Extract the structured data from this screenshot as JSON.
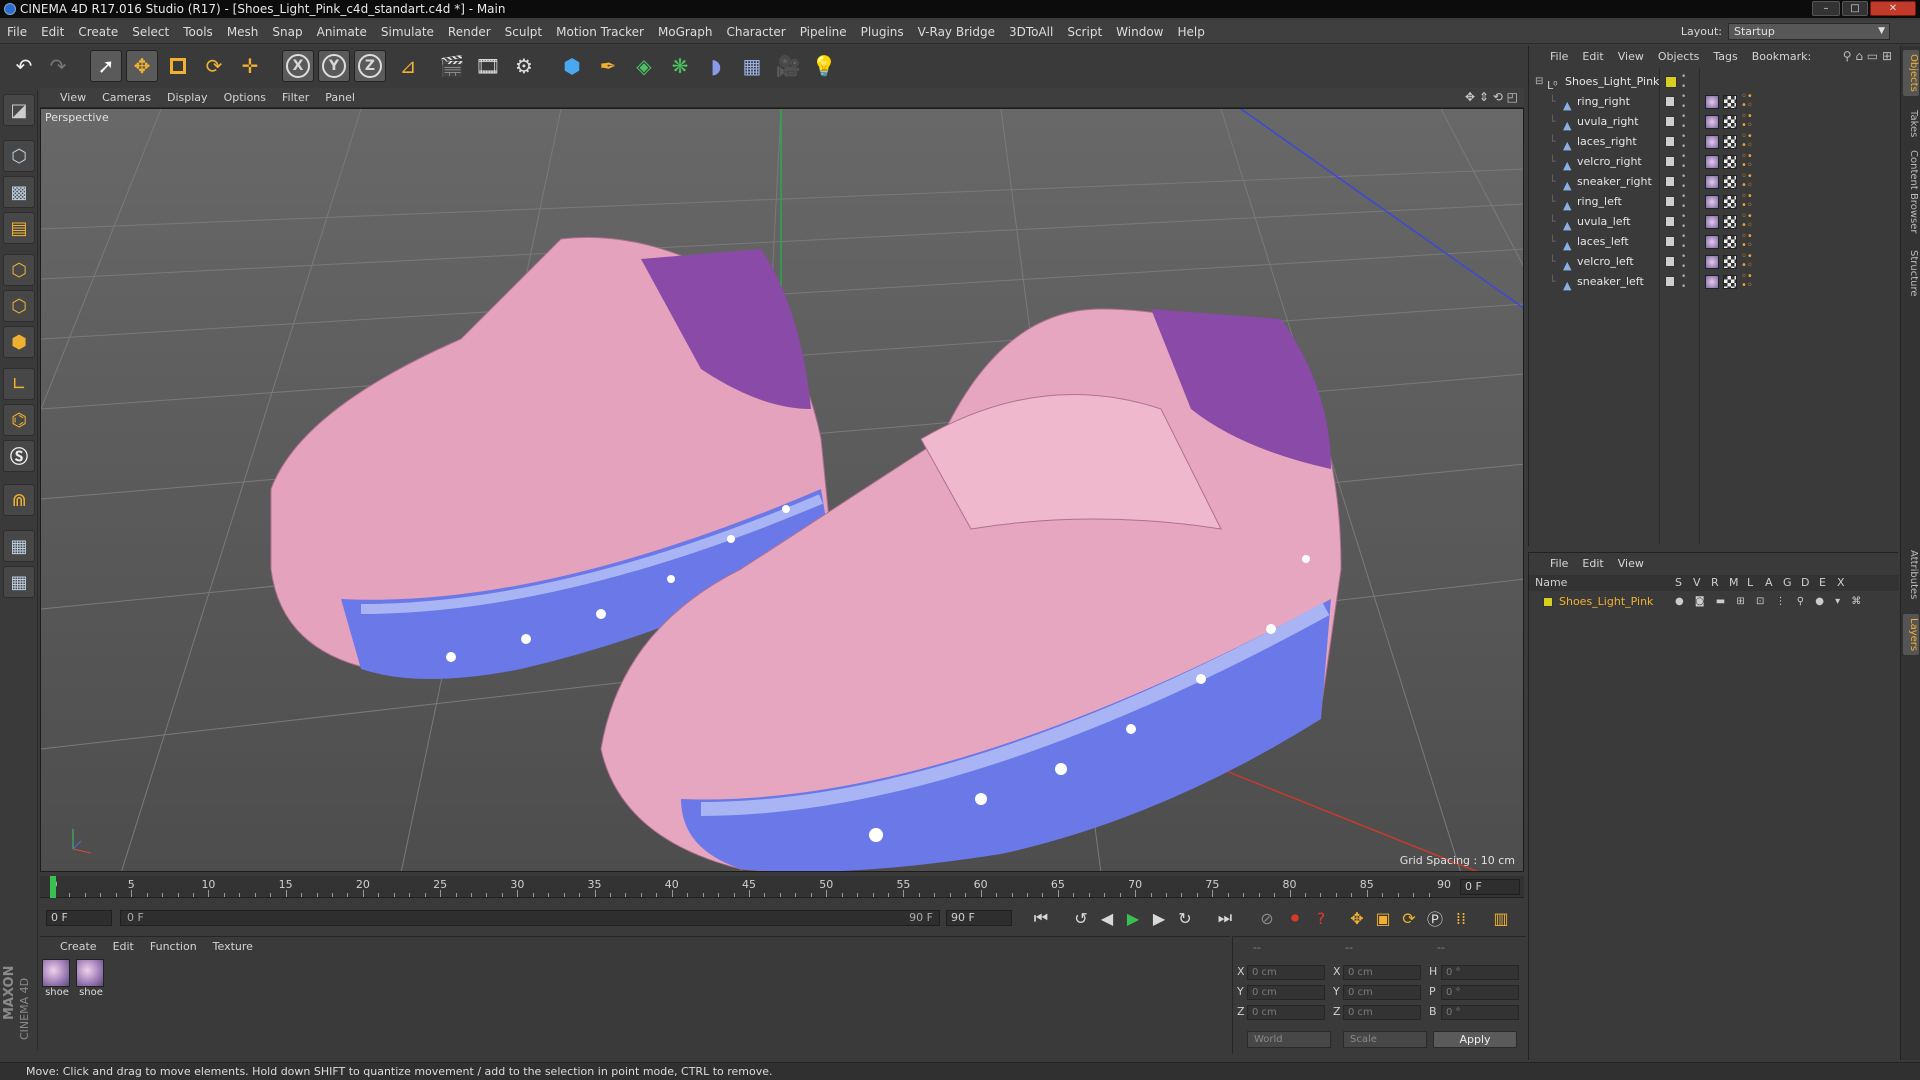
{
  "window": {
    "title": "CINEMA 4D R17.016 Studio (R17) - [Shoes_Light_Pink_c4d_standart.c4d *] - Main",
    "controls": [
      "–",
      "□",
      "✕"
    ]
  },
  "menubar": {
    "items": [
      "File",
      "Edit",
      "Create",
      "Select",
      "Tools",
      "Mesh",
      "Snap",
      "Animate",
      "Simulate",
      "Render",
      "Sculpt",
      "Motion Tracker",
      "MoGraph",
      "Character",
      "Pipeline",
      "Plugins",
      "V-Ray Bridge",
      "3DToAll",
      "Script",
      "Window",
      "Help"
    ],
    "layout_label": "Layout:",
    "layout_value": "Startup"
  },
  "toolbar": {
    "axis_x": "X",
    "axis_y": "Y",
    "axis_z": "Z"
  },
  "viewport": {
    "menu": [
      "View",
      "Cameras",
      "Display",
      "Options",
      "Filter",
      "Panel"
    ],
    "label": "Perspective",
    "grid_spacing": "Grid Spacing : 10 cm"
  },
  "timeline": {
    "ticks": [
      "0",
      "5",
      "10",
      "15",
      "20",
      "25",
      "30",
      "35",
      "40",
      "45",
      "50",
      "55",
      "60",
      "65",
      "70",
      "75",
      "80",
      "85",
      "90"
    ],
    "current_frame": "0 F",
    "start_field": "0 F",
    "range_start": "0 F",
    "range_end": "90 F",
    "end_field": "90 F"
  },
  "material_panel": {
    "menu": [
      "Create",
      "Edit",
      "Function",
      "Texture"
    ],
    "materials": [
      "shoe",
      "shoe"
    ]
  },
  "coordinates": {
    "header": [
      "--",
      "--",
      "--"
    ],
    "rows": [
      {
        "axis": "X",
        "pos": "0 cm",
        "axis2": "X",
        "size": "0 cm",
        "axis3": "H",
        "rot": "0 °"
      },
      {
        "axis": "Y",
        "pos": "0 cm",
        "axis2": "Y",
        "size": "0 cm",
        "axis3": "P",
        "rot": "0 °"
      },
      {
        "axis": "Z",
        "pos": "0 cm",
        "axis2": "Z",
        "size": "0 cm",
        "axis3": "B",
        "rot": "0 °"
      }
    ],
    "space": "World",
    "mode": "Scale",
    "apply": "Apply"
  },
  "status": "Move: Click and drag to move elements. Hold down SHIFT to quantize movement / add to the selection in point mode, CTRL to remove.",
  "object_manager": {
    "menu": [
      "File",
      "Edit",
      "View",
      "Objects",
      "Tags",
      "Bookmark:"
    ],
    "root": "Shoes_Light_Pink",
    "objects": [
      "ring_right",
      "uvula_right",
      "laces_right",
      "velcro_right",
      "sneaker_right",
      "ring_left",
      "uvula_left",
      "laces_left",
      "velcro_left",
      "sneaker_left"
    ]
  },
  "layer_manager": {
    "menu": [
      "File",
      "Edit",
      "View"
    ],
    "columns": [
      "Name",
      "S",
      "V",
      "R",
      "M",
      "L",
      "A",
      "G",
      "D",
      "E",
      "X"
    ],
    "layers": [
      "Shoes_Light_Pink"
    ]
  },
  "right_tabs": [
    "Objects",
    "Takes",
    "Content Browser",
    "Structure",
    "Attributes",
    "Layers"
  ],
  "logo": {
    "line1": "MAXON",
    "line2": "CINEMA 4D"
  },
  "colors": {
    "accent": "#f0b030",
    "layer_yellow": "#d8d020",
    "shoe_pink": "#e8a8c0",
    "sole_blue": "#6a78e8"
  }
}
